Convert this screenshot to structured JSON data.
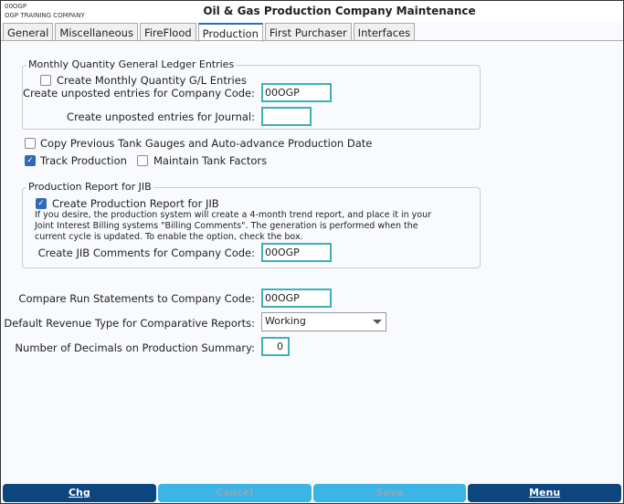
{
  "header": {
    "company_code": "00OGP",
    "company_name": "OGP TRAINING COMPANY",
    "title": "Oil & Gas Production Company Maintenance"
  },
  "tabs": [
    {
      "label": "General"
    },
    {
      "label": "Miscellaneous"
    },
    {
      "label": "FireFlood"
    },
    {
      "label": "Production",
      "active": true
    },
    {
      "label": "First Purchaser"
    },
    {
      "label": "Interfaces"
    }
  ],
  "gl": {
    "legend": "Monthly Quantity General Ledger Entries",
    "create_label": "Create Monthly Quantity G/L Entries",
    "create_checked": false,
    "company_label": "Create unposted entries for Company Code:",
    "company_value": "00OGP",
    "journal_label": "Create unposted entries for Journal:",
    "journal_value": ""
  },
  "options": {
    "copy_label": "Copy Previous Tank Gauges and Auto-advance Production Date",
    "copy_checked": false,
    "track_label": "Track Production",
    "track_checked": true,
    "tank_label": "Maintain Tank Factors",
    "tank_checked": false
  },
  "jib": {
    "legend": "Production Report for JIB",
    "create_label": "Create Production Report for JIB",
    "create_checked": true,
    "desc_lines": [
      "If you desire, the production system will create a 4-month trend report, and place it in your",
      "Joint Interest Billing systems \"Billing Comments\". The generation is performed when the",
      "current cycle is updated. To enable the option, check the box."
    ],
    "company_label": "Create JIB Comments for Company Code:",
    "company_value": "00OGP"
  },
  "compare": {
    "label": "Compare Run Statements to Company Code:",
    "value": "00OGP"
  },
  "revenue": {
    "label": "Default Revenue Type for Comparative Reports:",
    "value": "Working"
  },
  "decimals": {
    "label": "Number of Decimals on Production Summary:",
    "value": "0"
  },
  "footer": {
    "chg": "Chg",
    "cancel": "Cancel",
    "save": "Save",
    "menu": "Menu"
  },
  "colors": {
    "accent": "#0d467e",
    "disabled": "#3cb4e6",
    "input_border": "#3fb0b8"
  }
}
